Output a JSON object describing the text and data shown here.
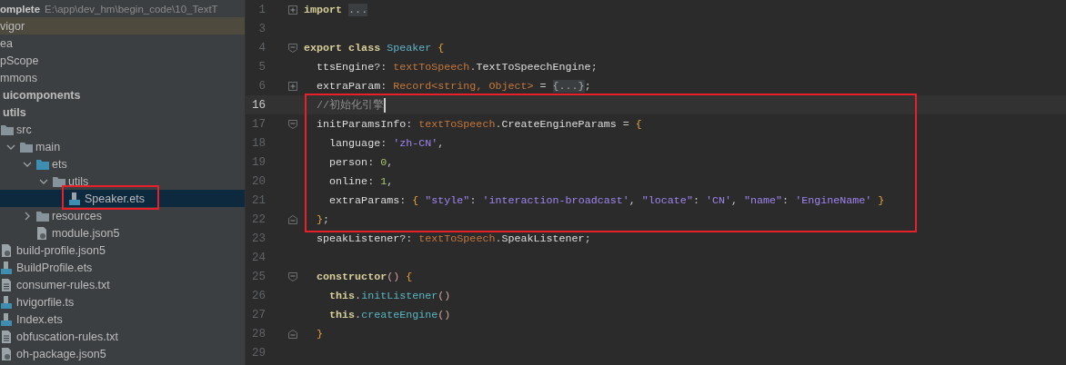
{
  "project_header": {
    "name": "omplete",
    "path": "E:\\app\\dev_hm\\begin_code\\10_TextT"
  },
  "tree": {
    "items": [
      {
        "label": "vigor",
        "selected": false,
        "highlighted": true,
        "boxed": false
      },
      {
        "label": "ea",
        "selected": false,
        "highlighted": false,
        "boxed": false
      },
      {
        "label": "pScope",
        "selected": false,
        "highlighted": false,
        "boxed": false
      },
      {
        "label": "mmons",
        "selected": false,
        "highlighted": false,
        "boxed": false,
        "children": [
          {
            "label": "uicomponents",
            "kind": "module",
            "selected": false,
            "highlighted": false,
            "boxed": false
          },
          {
            "label": "utils",
            "kind": "module",
            "selected": false,
            "highlighted": false,
            "boxed": false,
            "children": [
              {
                "label": "src",
                "kind": "folder",
                "selected": false,
                "highlighted": false,
                "boxed": false,
                "children": [
                  {
                    "label": "main",
                    "kind": "folder",
                    "expanded": true,
                    "selected": false,
                    "highlighted": false,
                    "boxed": false,
                    "children": [
                      {
                        "label": "ets",
                        "kind": "source-folder",
                        "expanded": true,
                        "selected": false,
                        "highlighted": false,
                        "boxed": false,
                        "children": [
                          {
                            "label": "utils",
                            "kind": "folder",
                            "expanded": true,
                            "selected": false,
                            "highlighted": false,
                            "boxed": false,
                            "children": [
                              {
                                "label": "Speaker.ets",
                                "kind": "ets",
                                "selected": true,
                                "highlighted": false,
                                "boxed": true
                              }
                            ]
                          }
                        ]
                      },
                      {
                        "label": "resources",
                        "kind": "folder",
                        "expanded": false,
                        "selected": false,
                        "highlighted": false,
                        "boxed": false
                      },
                      {
                        "label": "module.json5",
                        "kind": "json",
                        "selected": false,
                        "highlighted": false,
                        "boxed": false
                      }
                    ]
                  }
                ]
              },
              {
                "label": "build-profile.json5",
                "kind": "json",
                "selected": false,
                "highlighted": false,
                "boxed": false
              },
              {
                "label": "BuildProfile.ets",
                "kind": "ets",
                "selected": false,
                "highlighted": false,
                "boxed": false
              },
              {
                "label": "consumer-rules.txt",
                "kind": "txt",
                "selected": false,
                "highlighted": false,
                "boxed": false
              },
              {
                "label": "hvigorfile.ts",
                "kind": "ts",
                "selected": false,
                "highlighted": false,
                "boxed": false
              },
              {
                "label": "Index.ets",
                "kind": "ets",
                "selected": false,
                "highlighted": false,
                "boxed": false
              },
              {
                "label": "obfuscation-rules.txt",
                "kind": "txt",
                "selected": false,
                "highlighted": false,
                "boxed": false
              },
              {
                "label": "oh-package.json5",
                "kind": "json",
                "selected": false,
                "highlighted": false,
                "boxed": false
              }
            ]
          }
        ]
      }
    ]
  },
  "editor": {
    "sections": [
      {
        "framed": false,
        "lines": [
          {
            "number": "1",
            "kind": "folded",
            "current": false,
            "caret": false,
            "tokens": [
              {
                "kind": "kw",
                "text": "import "
              },
              {
                "kind": "folded",
                "text": "..."
              }
            ]
          },
          {
            "number": "3",
            "kind": "plain",
            "current": false,
            "caret": false
          },
          {
            "number": "4",
            "kind": "block-start",
            "current": false,
            "caret": false,
            "tokens": [
              {
                "kind": "kw",
                "text": "export class "
              },
              {
                "kind": "cls",
                "text": "Speaker "
              },
              {
                "kind": "brace",
                "text": "{"
              }
            ]
          },
          {
            "number": "5",
            "kind": "plain",
            "current": false,
            "caret": false,
            "tokens": [
              {
                "kind": "prop",
                "text": "  ttsEngine"
              },
              {
                "kind": "punc",
                "text": "?: "
              },
              {
                "kind": "type",
                "text": "textToSpeech"
              },
              {
                "kind": "punc",
                "text": "."
              },
              {
                "kind": "prop",
                "text": "TextToSpeechEngine"
              },
              {
                "kind": "punc",
                "text": ";"
              }
            ]
          },
          {
            "number": "6",
            "kind": "folded",
            "current": false,
            "caret": false,
            "tokens": [
              {
                "kind": "prop",
                "text": "  extraParam"
              },
              {
                "kind": "punc",
                "text": ": "
              },
              {
                "kind": "type",
                "text": "Record<string, Object>"
              },
              {
                "kind": "punc",
                "text": " = "
              },
              {
                "kind": "folded",
                "text": "{...}"
              },
              {
                "kind": "punc",
                "text": ";"
              }
            ]
          }
        ]
      },
      {
        "framed": true,
        "lines": [
          {
            "number": "16",
            "kind": "plain",
            "current": true,
            "caret": true,
            "tokens": [
              {
                "kind": "comment",
                "text": "  //初始化引擎"
              }
            ]
          },
          {
            "number": "17",
            "kind": "block-start",
            "current": false,
            "caret": false,
            "tokens": [
              {
                "kind": "prop",
                "text": "  initParamsInfo"
              },
              {
                "kind": "punc",
                "text": ": "
              },
              {
                "kind": "type",
                "text": "textToSpeech"
              },
              {
                "kind": "punc",
                "text": "."
              },
              {
                "kind": "prop",
                "text": "CreateEngineParams"
              },
              {
                "kind": "punc",
                "text": " = "
              },
              {
                "kind": "brace",
                "text": "{"
              }
            ]
          },
          {
            "number": "18",
            "kind": "plain",
            "current": false,
            "caret": false,
            "tokens": [
              {
                "kind": "prop",
                "text": "    language"
              },
              {
                "kind": "punc",
                "text": ": "
              },
              {
                "kind": "str",
                "text": "'zh-CN'"
              },
              {
                "kind": "punc",
                "text": ","
              }
            ]
          },
          {
            "number": "19",
            "kind": "plain",
            "current": false,
            "caret": false,
            "tokens": [
              {
                "kind": "prop",
                "text": "    person"
              },
              {
                "kind": "punc",
                "text": ": "
              },
              {
                "kind": "num",
                "text": "0"
              },
              {
                "kind": "punc",
                "text": ","
              }
            ]
          },
          {
            "number": "20",
            "kind": "plain",
            "current": false,
            "caret": false,
            "tokens": [
              {
                "kind": "prop",
                "text": "    online"
              },
              {
                "kind": "punc",
                "text": ": "
              },
              {
                "kind": "num",
                "text": "1"
              },
              {
                "kind": "punc",
                "text": ","
              }
            ]
          },
          {
            "number": "21",
            "kind": "plain",
            "current": false,
            "caret": false,
            "tokens": [
              {
                "kind": "prop",
                "text": "    extraParams"
              },
              {
                "kind": "punc",
                "text": ": "
              },
              {
                "kind": "brace",
                "text": "{ "
              },
              {
                "kind": "str",
                "text": "\"style\""
              },
              {
                "kind": "punc",
                "text": ": "
              },
              {
                "kind": "str",
                "text": "'interaction-broadcast'"
              },
              {
                "kind": "punc",
                "text": ", "
              },
              {
                "kind": "str",
                "text": "\"locate\""
              },
              {
                "kind": "punc",
                "text": ": "
              },
              {
                "kind": "str",
                "text": "'CN'"
              },
              {
                "kind": "punc",
                "text": ", "
              },
              {
                "kind": "str",
                "text": "\"name\""
              },
              {
                "kind": "punc",
                "text": ": "
              },
              {
                "kind": "str",
                "text": "'EngineName' "
              },
              {
                "kind": "brace",
                "text": "}"
              }
            ]
          },
          {
            "number": "22",
            "kind": "block-end",
            "current": false,
            "caret": false,
            "tokens": [
              {
                "kind": "brace",
                "text": "  }"
              },
              {
                "kind": "punc",
                "text": ";"
              }
            ]
          }
        ]
      },
      {
        "framed": false,
        "lines": [
          {
            "number": "23",
            "kind": "plain",
            "current": false,
            "caret": false,
            "tokens": [
              {
                "kind": "prop",
                "text": "  speakListener"
              },
              {
                "kind": "punc",
                "text": "?: "
              },
              {
                "kind": "type",
                "text": "textToSpeech"
              },
              {
                "kind": "punc",
                "text": "."
              },
              {
                "kind": "prop",
                "text": "SpeakListener"
              },
              {
                "kind": "punc",
                "text": ";"
              }
            ]
          },
          {
            "number": "24",
            "kind": "plain",
            "current": false,
            "caret": false
          },
          {
            "number": "25",
            "kind": "block-start",
            "current": false,
            "caret": false,
            "tokens": [
              {
                "kind": "kw",
                "text": "  constructor"
              },
              {
                "kind": "paren",
                "text": "() "
              },
              {
                "kind": "brace",
                "text": "{"
              }
            ]
          },
          {
            "number": "26",
            "kind": "plain",
            "current": false,
            "caret": false,
            "tokens": [
              {
                "kind": "kw",
                "text": "    this"
              },
              {
                "kind": "punc",
                "text": "."
              },
              {
                "kind": "fn",
                "text": "initListener"
              },
              {
                "kind": "paren",
                "text": "()"
              }
            ]
          },
          {
            "number": "27",
            "kind": "plain",
            "current": false,
            "caret": false,
            "tokens": [
              {
                "kind": "kw",
                "text": "    this"
              },
              {
                "kind": "punc",
                "text": "."
              },
              {
                "kind": "fn",
                "text": "createEngine"
              },
              {
                "kind": "paren",
                "text": "()"
              }
            ]
          },
          {
            "number": "28",
            "kind": "block-end",
            "current": false,
            "caret": false,
            "tokens": [
              {
                "kind": "brace",
                "text": "  }"
              }
            ]
          },
          {
            "number": "29",
            "kind": "plain",
            "current": false,
            "caret": false
          }
        ]
      }
    ]
  }
}
